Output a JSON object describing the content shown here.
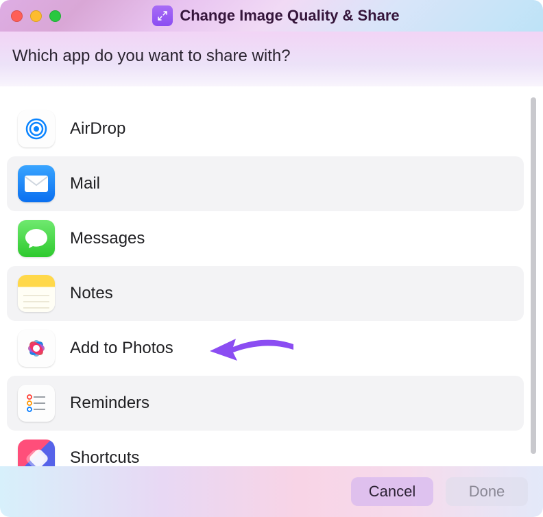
{
  "window": {
    "title": "Change Image Quality & Share",
    "prompt": "Which app do you want to share with?"
  },
  "apps": [
    {
      "id": "airdrop",
      "label": "AirDrop"
    },
    {
      "id": "mail",
      "label": "Mail"
    },
    {
      "id": "messages",
      "label": "Messages"
    },
    {
      "id": "notes",
      "label": "Notes"
    },
    {
      "id": "photos",
      "label": "Add to Photos"
    },
    {
      "id": "reminders",
      "label": "Reminders"
    },
    {
      "id": "shortcuts",
      "label": "Shortcuts"
    }
  ],
  "footer": {
    "cancel": "Cancel",
    "done": "Done"
  },
  "annotation": {
    "arrow_target_index": 4,
    "arrow_color": "#8b4df2"
  }
}
